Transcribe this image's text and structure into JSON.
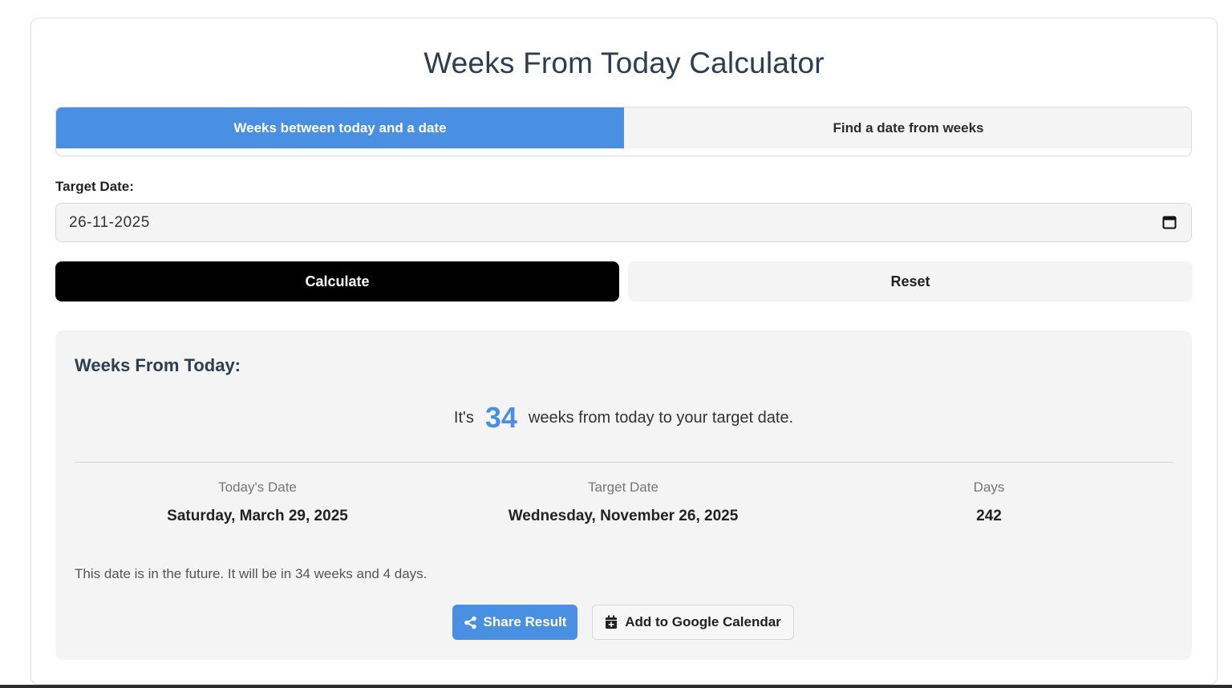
{
  "title": "Weeks From Today Calculator",
  "tabs": [
    {
      "label": "Weeks between today and a date",
      "active": true
    },
    {
      "label": "Find a date from weeks",
      "active": false
    }
  ],
  "form": {
    "target_label": "Target Date:",
    "target_value": "26-11-2025",
    "calendar_icon": "calendar-icon"
  },
  "buttons": {
    "calculate": "Calculate",
    "reset": "Reset",
    "share": "Share Result",
    "share_icon": "share-icon",
    "gcal": "Add to Google Calendar",
    "gcal_icon": "calendar-plus-icon"
  },
  "results": {
    "heading": "Weeks From Today:",
    "summary_prefix": "It's",
    "weeks": "34",
    "summary_suffix": "weeks from today to your target date.",
    "today_label": "Today's Date",
    "today_value": "Saturday, March 29, 2025",
    "target_label": "Target Date",
    "target_value": "Wednesday, November 26, 2025",
    "days_label": "Days",
    "days_value": "242",
    "note": "This date is in the future. It will be in 34 weeks and 4 days."
  },
  "colors": {
    "accent": "#4a90e2",
    "primary_button": "#000000",
    "panel_bg": "#f4f4f4",
    "heading": "#2c3e50"
  }
}
